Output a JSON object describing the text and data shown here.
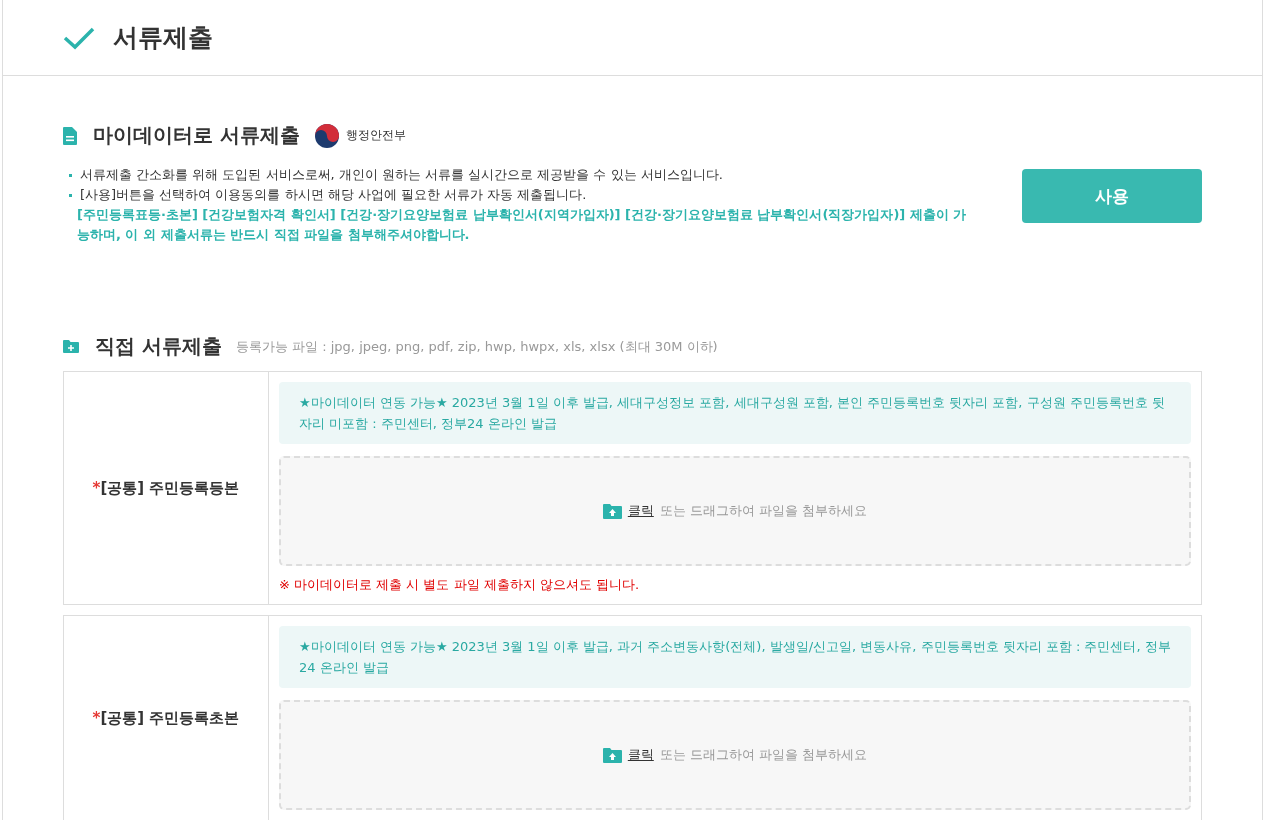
{
  "page_title": "서류제출",
  "mydata": {
    "title": "마이데이터로 서류제출",
    "logo_text": "행정안전부",
    "bullets": [
      "서류제출 간소화를 위해 도입된 서비스로써, 개인이 원하는 서류를 실시간으로 제공받을 수 있는 서비스입니다.",
      "[사용]버튼을 선택하여 이용동의를 하시면 해당 사업에 필요한 서류가 자동 제출됩니다."
    ],
    "note": "[주민등록표등·초본] [건강보험자격 확인서] [건강·장기요양보험료 납부확인서(지역가입자)] [건강·장기요양보험료 납부확인서(직장가입자)] 제출이 가능하며, 이 외 제출서류는 반드시 직접 파일을 첨부해주셔야합니다.",
    "button": "사용"
  },
  "direct": {
    "title": "직접 서류제출",
    "hint": "등록가능 파일 : jpg, jpeg, png, pdf, zip, hwp, hwpx, xls, xlsx (최대 30M 이하)",
    "rows": [
      {
        "required": true,
        "star": "*",
        "label": "[공통] 주민등록등본",
        "info": "★마이데이터 연동 가능★ 2023년 3월 1일 이후 발급, 세대구성정보 포함, 세대구성원 포함, 본인 주민등록번호 뒷자리 포함, 구성원 주민등록번호 뒷자리 미포함 : 주민센터, 정부24 온라인 발급",
        "link": "클릭",
        "prompt": "또는 드래그하여 파일을 첨부하세요",
        "note": "※ 마이데이터로 제출 시 별도 파일 제출하지 않으셔도 됩니다."
      },
      {
        "required": true,
        "star": "*",
        "label": "[공통] 주민등록초본",
        "info": "★마이데이터 연동 가능★ 2023년 3월 1일 이후 발급, 과거 주소변동사항(전체), 발생일/신고일, 변동사유, 주민등록번호 뒷자리 포함 : 주민센터, 정부24 온라인 발급",
        "link": "클릭",
        "prompt": "또는 드래그하여 파일을 첨부하세요"
      }
    ]
  }
}
